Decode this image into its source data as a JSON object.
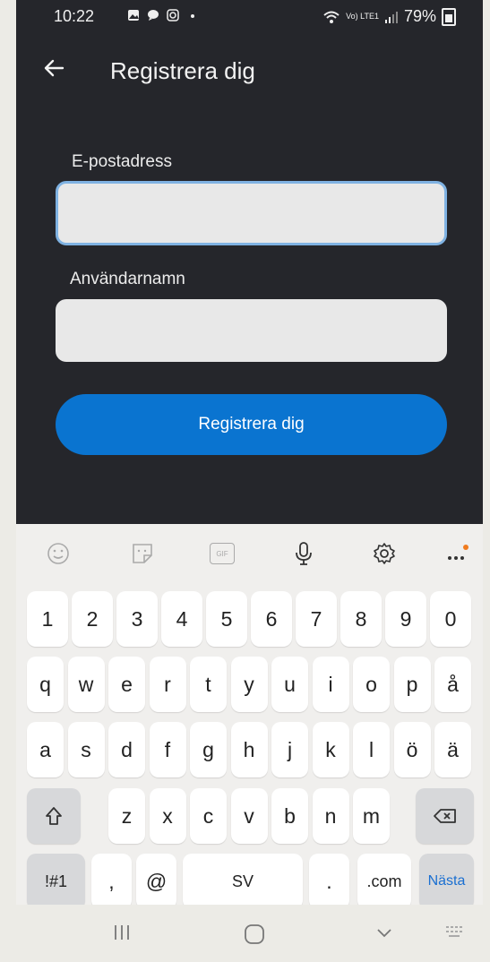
{
  "status": {
    "time": "10:22",
    "network": "Vo) LTE1",
    "battery": "79%"
  },
  "header": {
    "title": "Registrera dig",
    "back_icon": "arrow-left-icon"
  },
  "form": {
    "email_label": "E-postadress",
    "email_value": "",
    "username_label": "Användarnamn",
    "username_value": "",
    "submit_label": "Registrera dig"
  },
  "keyboard": {
    "toolbar": [
      "emoji-icon",
      "sticker-icon",
      "gif-icon",
      "microphone-icon",
      "settings-icon",
      "more-icon"
    ],
    "gif_label": "GIF",
    "row1": [
      "1",
      "2",
      "3",
      "4",
      "5",
      "6",
      "7",
      "8",
      "9",
      "0"
    ],
    "row2": [
      "q",
      "w",
      "e",
      "r",
      "t",
      "y",
      "u",
      "i",
      "o",
      "p",
      "å"
    ],
    "row3": [
      "a",
      "s",
      "d",
      "f",
      "g",
      "h",
      "j",
      "k",
      "l",
      "ö",
      "ä"
    ],
    "row4": [
      "z",
      "x",
      "c",
      "v",
      "b",
      "n",
      "m"
    ],
    "sym_label": "!#1",
    "comma_label": ",",
    "at_label": "@",
    "space_label": "SV",
    "dot_label": ".",
    "com_label": ".com",
    "next_label": "Nästa"
  },
  "colors": {
    "app_bg": "#25262b",
    "primary": "#0a74d0",
    "focus_border": "#7fb2e2"
  }
}
